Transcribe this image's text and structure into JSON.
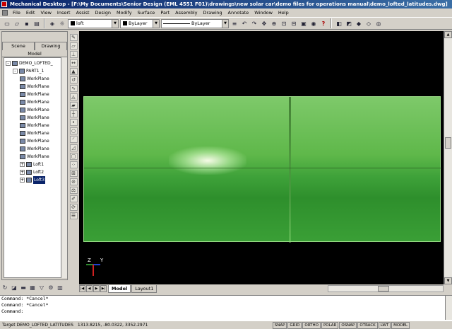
{
  "window": {
    "title": "Mechanical Desktop - [F:\\My Documents\\Senior Design (EML 4551 F01)\\drawings\\new solar car\\demo files for operations manual\\demo_lofted_latitudes.dwg]"
  },
  "menu": {
    "items": [
      "File",
      "Edit",
      "View",
      "Insert",
      "Assist",
      "Design",
      "Modify",
      "Surface",
      "Part",
      "Assembly",
      "Drawing",
      "Annotate",
      "Window",
      "Help"
    ]
  },
  "toolbar": {
    "layer_value": "loft",
    "color_value": "ByLayer",
    "linetype_value": "ByLayer"
  },
  "browser": {
    "tabs": [
      "Scene",
      "Drawing"
    ],
    "subtab": "Model",
    "tree": [
      {
        "label": "DEMO_LOFTED_",
        "expander": "-",
        "indent": 0
      },
      {
        "label": "PART1_1",
        "expander": "-",
        "indent": 1
      },
      {
        "label": "WorkPlane",
        "expander": "",
        "indent": 2
      },
      {
        "label": "WorkPlane",
        "expander": "",
        "indent": 2
      },
      {
        "label": "WorkPlane",
        "expander": "",
        "indent": 2
      },
      {
        "label": "WorkPlane",
        "expander": "",
        "indent": 2
      },
      {
        "label": "WorkPlane",
        "expander": "",
        "indent": 2
      },
      {
        "label": "WorkPlane",
        "expander": "",
        "indent": 2
      },
      {
        "label": "WorkPlane",
        "expander": "",
        "indent": 2
      },
      {
        "label": "WorkPlane",
        "expander": "",
        "indent": 2
      },
      {
        "label": "WorkPlane",
        "expander": "",
        "indent": 2
      },
      {
        "label": "WorkPlane",
        "expander": "",
        "indent": 2
      },
      {
        "label": "WorkPlane",
        "expander": "",
        "indent": 2
      },
      {
        "label": "Loft1",
        "expander": "+",
        "indent": 2
      },
      {
        "label": "Loft2",
        "expander": "+",
        "indent": 2
      },
      {
        "label": "Loft3",
        "expander": "+",
        "indent": 2,
        "selected": true
      }
    ]
  },
  "layout_tabs": [
    "Model",
    "Layout1"
  ],
  "command_lines": [
    "Command: *Cancel*",
    "Command: *Cancel*",
    "Command:"
  ],
  "status": {
    "target": "Target DEMO_LOFTED_LATITUDES",
    "coords": "1313.8215, -80.0322, 3352.2971",
    "toggles": [
      "SNAP",
      "GRID",
      "ORTHO",
      "POLAR",
      "OSNAP",
      "OTRACK",
      "LWT",
      "MODEL"
    ]
  },
  "colors": {
    "viewport_bg": "#000000",
    "surface": "#4caf40",
    "titlebar": "#0a246a"
  }
}
